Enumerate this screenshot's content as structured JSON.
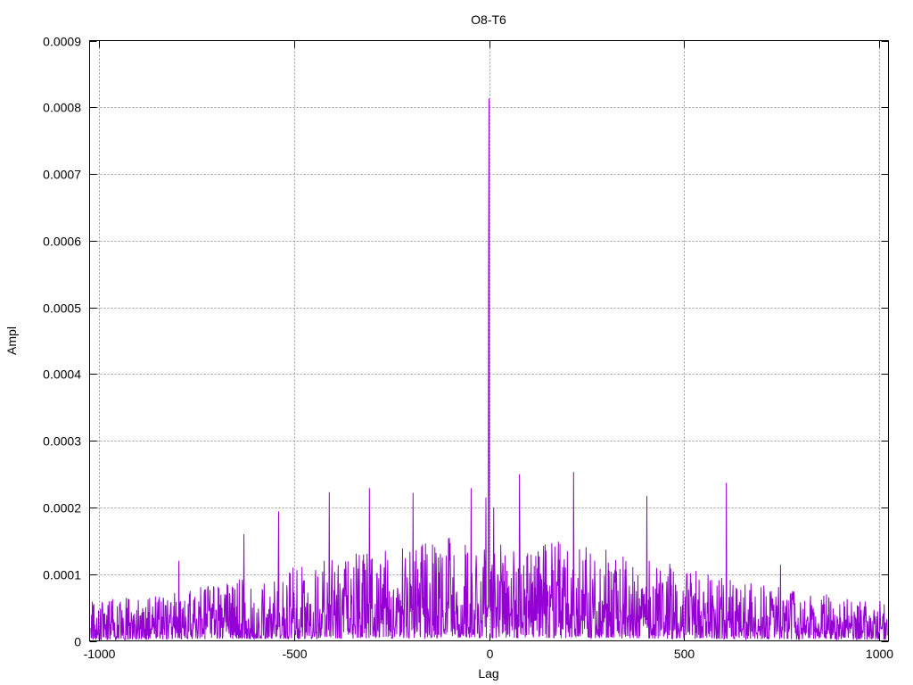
{
  "chart_data": {
    "type": "line",
    "title": "O8-T6",
    "xlabel": "Lag",
    "ylabel": "Ampl",
    "xlim": [
      -1025,
      1025
    ],
    "ylim": [
      0,
      0.0009
    ],
    "xticks": [
      -1000,
      -500,
      0,
      500,
      1000
    ],
    "xtick_labels": [
      "-1000",
      "-500",
      "0",
      "500",
      "1000"
    ],
    "yticks": [
      0,
      0.0001,
      0.0002,
      0.0003,
      0.0004,
      0.0005,
      0.0006,
      0.0007,
      0.0008,
      0.0009
    ],
    "ytick_labels": [
      "0",
      "0.0001",
      "0.0002",
      "0.0003",
      "0.0004",
      "0.0005",
      "0.0006",
      "0.0007",
      "0.0008",
      "0.0009"
    ],
    "grid": true,
    "series": [
      {
        "name": "O8-T6",
        "color": "#9400D3",
        "noise_model": {
          "seed": 8,
          "edge_level": 3e-05,
          "center_level": 9e-05,
          "width_lags": 650
        },
        "peaks": [
          {
            "x": 0,
            "y": 0.000813
          },
          {
            "x": -1,
            "y": 0.000582
          },
          {
            "x": -540,
            "y": 0.000194
          },
          {
            "x": -410,
            "y": 0.000223
          },
          {
            "x": -307,
            "y": 0.000229
          },
          {
            "x": -195,
            "y": 0.000222
          },
          {
            "x": -46,
            "y": 0.000229
          },
          {
            "x": 78,
            "y": 0.00025
          },
          {
            "x": 217,
            "y": 0.000253
          },
          {
            "x": 405,
            "y": 0.000217
          },
          {
            "x": 609,
            "y": 0.000237
          },
          {
            "x": -796,
            "y": 0.00012
          },
          {
            "x": 748,
            "y": 0.000114
          },
          {
            "x": -629,
            "y": 0.00016
          },
          {
            "x": -8,
            "y": 0.000215
          },
          {
            "x": 12,
            "y": 0.0002
          }
        ]
      }
    ]
  }
}
